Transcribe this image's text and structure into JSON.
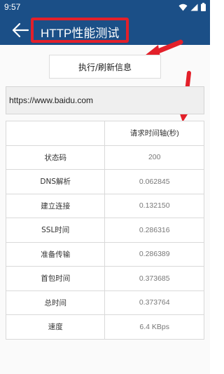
{
  "status_bar": {
    "time": "9:57",
    "icons": [
      "wifi-icon",
      "signal-icon",
      "battery-icon"
    ]
  },
  "app_bar": {
    "title": "HTTP性能测试",
    "back_icon": "back-arrow-icon",
    "color": "#1b4f87"
  },
  "annotation_color": "#e3202a",
  "exec_button": {
    "label": "执行/刷新信息"
  },
  "url_input": {
    "value": "https://www.baidu.com"
  },
  "table": {
    "header": [
      "",
      "请求时间轴(秒)"
    ],
    "rows": [
      {
        "label": "状态码",
        "value": "200"
      },
      {
        "label": "DNS解析",
        "value": "0.062845"
      },
      {
        "label": "建立连接",
        "value": "0.132150"
      },
      {
        "label": "SSL时间",
        "value": "0.286316"
      },
      {
        "label": "准备传输",
        "value": "0.286389"
      },
      {
        "label": "首包时间",
        "value": "0.373685"
      },
      {
        "label": "总时间",
        "value": "0.373764"
      },
      {
        "label": "速度",
        "value": "6.4 KBps"
      }
    ]
  }
}
